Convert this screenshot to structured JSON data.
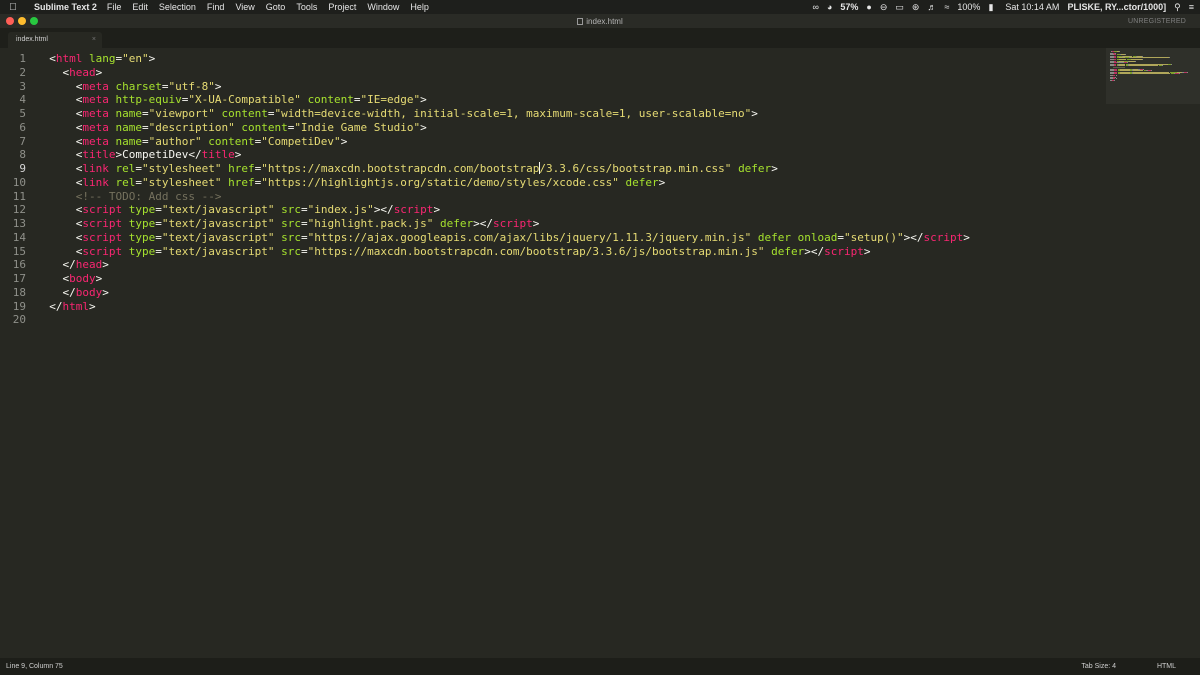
{
  "menubar": {
    "app_name": "Sublime Text 2",
    "items": [
      "File",
      "Edit",
      "Selection",
      "Find",
      "View",
      "Goto",
      "Tools",
      "Project",
      "Window",
      "Help"
    ],
    "battery_icon_label": "57%",
    "battery_percent": "100%",
    "clock": "Sat 10:14 AM",
    "user": "PLISKE, RY...ctor/1000]"
  },
  "window": {
    "title": "index.html",
    "unregistered": "UNREGISTERED"
  },
  "tabs": [
    {
      "label": "index.html",
      "close": "×"
    }
  ],
  "editor": {
    "current_line": 9,
    "line_numbers": [
      "1",
      "2",
      "3",
      "4",
      "5",
      "6",
      "7",
      "8",
      "9",
      "10",
      "11",
      "12",
      "13",
      "14",
      "15",
      "16",
      "17",
      "18",
      "19",
      "20"
    ],
    "lines": [
      [
        [
          "p",
          "  "
        ],
        [
          "p",
          "<"
        ],
        [
          "t",
          "html"
        ],
        [
          "p",
          " "
        ],
        [
          "a",
          "lang"
        ],
        [
          "p",
          "="
        ],
        [
          "s",
          "\"en\""
        ],
        [
          "p",
          ">"
        ]
      ],
      [
        [
          "p",
          "    <"
        ],
        [
          "t",
          "head"
        ],
        [
          "p",
          ">"
        ]
      ],
      [
        [
          "p",
          "      <"
        ],
        [
          "t",
          "meta"
        ],
        [
          "p",
          " "
        ],
        [
          "a",
          "charset"
        ],
        [
          "p",
          "="
        ],
        [
          "s",
          "\"utf-8\""
        ],
        [
          "p",
          ">"
        ]
      ],
      [
        [
          "p",
          "      <"
        ],
        [
          "t",
          "meta"
        ],
        [
          "p",
          " "
        ],
        [
          "a",
          "http-equiv"
        ],
        [
          "p",
          "="
        ],
        [
          "s",
          "\"X-UA-Compatible\""
        ],
        [
          "p",
          " "
        ],
        [
          "a",
          "content"
        ],
        [
          "p",
          "="
        ],
        [
          "s",
          "\"IE=edge\""
        ],
        [
          "p",
          ">"
        ]
      ],
      [
        [
          "p",
          "      <"
        ],
        [
          "t",
          "meta"
        ],
        [
          "p",
          " "
        ],
        [
          "a",
          "name"
        ],
        [
          "p",
          "="
        ],
        [
          "s",
          "\"viewport\""
        ],
        [
          "p",
          " "
        ],
        [
          "a",
          "content"
        ],
        [
          "p",
          "="
        ],
        [
          "s",
          "\"width=device-width, initial-scale=1, maximum-scale=1, user-scalable=no\""
        ],
        [
          "p",
          ">"
        ]
      ],
      [
        [
          "p",
          "      <"
        ],
        [
          "t",
          "meta"
        ],
        [
          "p",
          " "
        ],
        [
          "a",
          "name"
        ],
        [
          "p",
          "="
        ],
        [
          "s",
          "\"description\""
        ],
        [
          "p",
          " "
        ],
        [
          "a",
          "content"
        ],
        [
          "p",
          "="
        ],
        [
          "s",
          "\"Indie Game Studio\""
        ],
        [
          "p",
          ">"
        ]
      ],
      [
        [
          "p",
          "      <"
        ],
        [
          "t",
          "meta"
        ],
        [
          "p",
          " "
        ],
        [
          "a",
          "name"
        ],
        [
          "p",
          "="
        ],
        [
          "s",
          "\"author\""
        ],
        [
          "p",
          " "
        ],
        [
          "a",
          "content"
        ],
        [
          "p",
          "="
        ],
        [
          "s",
          "\"CompetiDev\""
        ],
        [
          "p",
          ">"
        ]
      ],
      [
        [
          "p",
          "      <"
        ],
        [
          "t",
          "title"
        ],
        [
          "p",
          ">CompetiDev</"
        ],
        [
          "t",
          "title"
        ],
        [
          "p",
          ">"
        ]
      ],
      [
        [
          "p",
          "      <"
        ],
        [
          "t",
          "link"
        ],
        [
          "p",
          " "
        ],
        [
          "a",
          "rel"
        ],
        [
          "p",
          "="
        ],
        [
          "s",
          "\"stylesheet\""
        ],
        [
          "p",
          " "
        ],
        [
          "a",
          "href"
        ],
        [
          "p",
          "="
        ],
        [
          "s",
          "\"https://maxcdn.bootstrapcdn.com/bootstrap"
        ],
        [
          "cursor",
          ""
        ],
        [
          "s",
          "/3.3.6/css/bootstrap.min.css\""
        ],
        [
          "p",
          " "
        ],
        [
          "a",
          "defer"
        ],
        [
          "p",
          ">"
        ]
      ],
      [
        [
          "p",
          "      <"
        ],
        [
          "t",
          "link"
        ],
        [
          "p",
          " "
        ],
        [
          "a",
          "rel"
        ],
        [
          "p",
          "="
        ],
        [
          "s",
          "\"stylesheet\""
        ],
        [
          "p",
          " "
        ],
        [
          "a",
          "href"
        ],
        [
          "p",
          "="
        ],
        [
          "s",
          "\"https://highlightjs.org/static/demo/styles/xcode.css\""
        ],
        [
          "p",
          " "
        ],
        [
          "a",
          "defer"
        ],
        [
          "p",
          ">"
        ]
      ],
      [
        [
          "p",
          "      "
        ],
        [
          "c",
          "<!-- TODO: Add css -->"
        ]
      ],
      [
        [
          "p",
          "      <"
        ],
        [
          "t",
          "script"
        ],
        [
          "p",
          " "
        ],
        [
          "a",
          "type"
        ],
        [
          "p",
          "="
        ],
        [
          "s",
          "\"text/javascript\""
        ],
        [
          "p",
          " "
        ],
        [
          "a",
          "src"
        ],
        [
          "p",
          "="
        ],
        [
          "s",
          "\"index.js\""
        ],
        [
          "p",
          "></"
        ],
        [
          "t",
          "script"
        ],
        [
          "p",
          ">"
        ]
      ],
      [
        [
          "p",
          "      <"
        ],
        [
          "t",
          "script"
        ],
        [
          "p",
          " "
        ],
        [
          "a",
          "type"
        ],
        [
          "p",
          "="
        ],
        [
          "s",
          "\"text/javascript\""
        ],
        [
          "p",
          " "
        ],
        [
          "a",
          "src"
        ],
        [
          "p",
          "="
        ],
        [
          "s",
          "\"highlight.pack.js\""
        ],
        [
          "p",
          " "
        ],
        [
          "a",
          "defer"
        ],
        [
          "p",
          "></"
        ],
        [
          "t",
          "script"
        ],
        [
          "p",
          ">"
        ]
      ],
      [
        [
          "p",
          "      <"
        ],
        [
          "t",
          "script"
        ],
        [
          "p",
          " "
        ],
        [
          "a",
          "type"
        ],
        [
          "p",
          "="
        ],
        [
          "s",
          "\"text/javascript\""
        ],
        [
          "p",
          " "
        ],
        [
          "a",
          "src"
        ],
        [
          "p",
          "="
        ],
        [
          "s",
          "\"https://ajax.googleapis.com/ajax/libs/jquery/1.11.3/jquery.min.js\""
        ],
        [
          "p",
          " "
        ],
        [
          "a",
          "defer"
        ],
        [
          "p",
          " "
        ],
        [
          "a",
          "onload"
        ],
        [
          "p",
          "="
        ],
        [
          "s",
          "\"setup()\""
        ],
        [
          "p",
          "></"
        ],
        [
          "t",
          "script"
        ],
        [
          "p",
          ">"
        ]
      ],
      [
        [
          "p",
          "      <"
        ],
        [
          "t",
          "script"
        ],
        [
          "p",
          " "
        ],
        [
          "a",
          "type"
        ],
        [
          "p",
          "="
        ],
        [
          "s",
          "\"text/javascript\""
        ],
        [
          "p",
          " "
        ],
        [
          "a",
          "src"
        ],
        [
          "p",
          "="
        ],
        [
          "s",
          "\"https://maxcdn.bootstrapcdn.com/bootstrap/3.3.6/js/bootstrap.min.js\""
        ],
        [
          "p",
          " "
        ],
        [
          "a",
          "defer"
        ],
        [
          "p",
          "></"
        ],
        [
          "t",
          "script"
        ],
        [
          "p",
          ">"
        ]
      ],
      [
        [
          "p",
          "    </"
        ],
        [
          "t",
          "head"
        ],
        [
          "p",
          ">"
        ]
      ],
      [
        [
          "p",
          "    <"
        ],
        [
          "t",
          "body"
        ],
        [
          "p",
          ">"
        ]
      ],
      [
        [
          "p",
          "    </"
        ],
        [
          "t",
          "body"
        ],
        [
          "p",
          ">"
        ]
      ],
      [
        [
          "p",
          "  </"
        ],
        [
          "t",
          "html"
        ],
        [
          "p",
          ">"
        ]
      ],
      []
    ]
  },
  "statusbar": {
    "position": "Line 9, Column 75",
    "tab_size": "Tab Size: 4",
    "syntax": "HTML"
  },
  "colors": {
    "background": "#272822",
    "tag": "#f92672",
    "attribute": "#a6e22e",
    "string": "#e6db74",
    "comment": "#75715e",
    "text": "#f8f8f2"
  },
  "icons": [
    "apple-icon",
    "glasses-icon",
    "battery-icon",
    "ellipsis-icon",
    "do-not-disturb-icon",
    "airplay-icon",
    "bluetooth-icon",
    "volume-icon",
    "wifi-icon",
    "battery-charging-icon",
    "search-icon",
    "list-icon",
    "document-icon",
    "close-icon"
  ]
}
